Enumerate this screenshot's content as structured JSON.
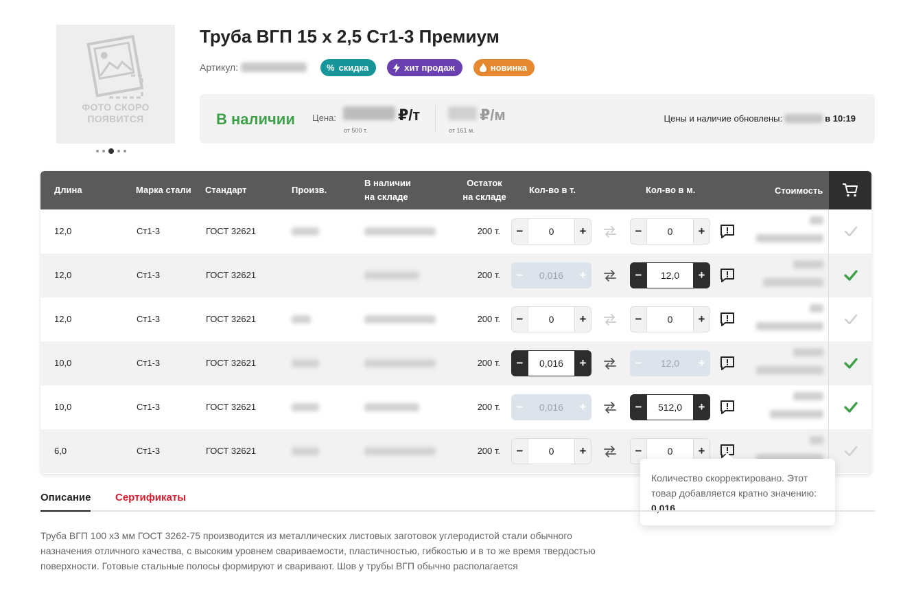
{
  "product": {
    "title": "Труба ВГП 15 х 2,5 Ст1-3 Премиум",
    "sku_label": "Артикул:",
    "photo_caption_1": "ФОТО СКОРО",
    "photo_caption_2": "ПОЯВИТСЯ",
    "gallery_dots": 5,
    "gallery_active": 3,
    "badges": [
      {
        "label": "скидка",
        "icon": "percent-icon",
        "color": "#17969a"
      },
      {
        "label": "хит продаж",
        "icon": "lightning-icon",
        "color": "#6a3fb0"
      },
      {
        "label": "новинка",
        "icon": "flame-icon",
        "color": "#e5882f"
      }
    ]
  },
  "stock": {
    "status": "В наличии",
    "price_label": "Цена:",
    "unit_t": "₽/т",
    "unit_m": "₽/м",
    "sub_t": "от 500 т.",
    "sub_m": "от 161 м.",
    "updated_label": "Цены и наличие обновлены:",
    "updated_time": "в 10:19"
  },
  "table": {
    "headers": {
      "length": "Длина",
      "steel": "Марка стали",
      "standard": "Стандарт",
      "maker": "Произв.",
      "avail_1": "В наличии",
      "avail_2": "на складе",
      "rest_1": "Остаток",
      "rest_2": "на складе",
      "qty_t": "Кол-во в т.",
      "qty_m": "Кол-во в м.",
      "cost": "Стоимость"
    },
    "rows": [
      {
        "length": "12,0",
        "steel": "Ст1-3",
        "standard": "ГОСТ 32621",
        "stock": "200 т.",
        "qty_t": "0",
        "qty_m": "0",
        "t_state": "normal",
        "m_state": "normal",
        "swap_active": false,
        "checked": false
      },
      {
        "length": "12,0",
        "steel": "Ст1-3",
        "standard": "ГОСТ 32621",
        "stock": "200 т.",
        "qty_t": "0,016",
        "qty_m": "12,0",
        "t_state": "disabled",
        "m_state": "dark",
        "swap_active": true,
        "checked": true
      },
      {
        "length": "12,0",
        "steel": "Ст1-3",
        "standard": "ГОСТ 32621",
        "stock": "200 т.",
        "qty_t": "0",
        "qty_m": "0",
        "t_state": "normal",
        "m_state": "normal",
        "swap_active": false,
        "checked": false
      },
      {
        "length": "10,0",
        "steel": "Ст1-3",
        "standard": "ГОСТ 32621",
        "stock": "200 т.",
        "qty_t": "0,016",
        "qty_m": "12,0",
        "t_state": "dark",
        "m_state": "disabled",
        "swap_active": true,
        "checked": true
      },
      {
        "length": "10,0",
        "steel": "Ст1-3",
        "standard": "ГОСТ 32621",
        "stock": "200 т.",
        "qty_t": "0,016",
        "qty_m": "512,0",
        "t_state": "disabled",
        "m_state": "dark",
        "swap_active": true,
        "checked": true
      },
      {
        "length": "6,0",
        "steel": "Ст1-3",
        "standard": "ГОСТ 32621",
        "stock": "200 т.",
        "qty_t": "0",
        "qty_m": "0",
        "t_state": "normal",
        "m_state": "normal",
        "swap_active": true,
        "checked": false
      }
    ]
  },
  "tooltip": {
    "text": "Количество скорректировано. Этот товар добавляется кратно значению:",
    "value": "0,016"
  },
  "tabs": {
    "description": "Описание",
    "certificates": "Сертификаты"
  },
  "description": "Труба ВГП 100 х3 мм ГОСТ 3262-75 производится из металлических листовых заготовок углеродистой стали обычного назначения отличного качества, с высоким уровнем свариваемости, пластичностью, гибкостью и в то же время твердостью поверхности. Готовые стальные полосы формируют и сваривают. Шов у трубы ВГП обычно располагается",
  "colors": {
    "accent_green": "#3ea14a",
    "accent_red": "#d11f2f",
    "header_dark": "#5a5a5a"
  }
}
